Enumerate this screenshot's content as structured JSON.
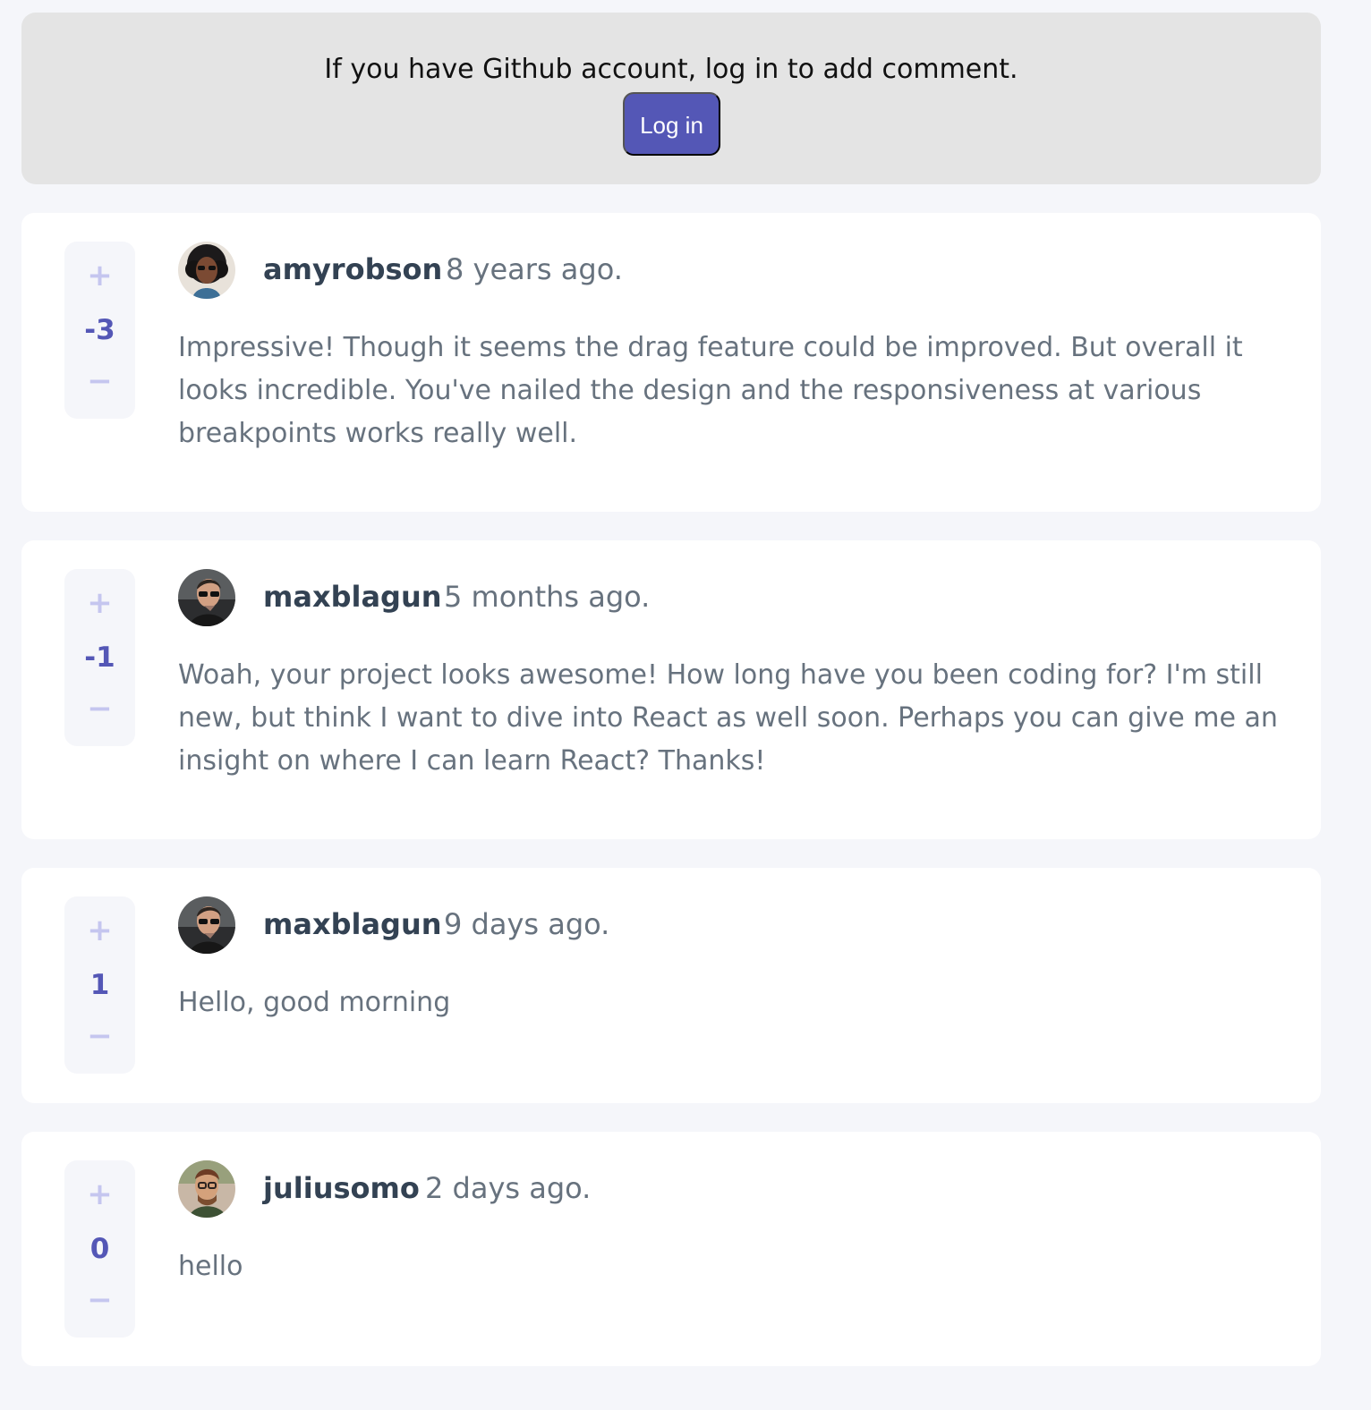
{
  "login_banner": {
    "text": "If you have Github account, log in to add comment.",
    "button_label": "Log in"
  },
  "comments": [
    {
      "score": "-3",
      "username": "amyrobson",
      "time": "8 years ago.",
      "text": "Impressive! Though it seems the drag feature could be improved. But overall it looks incredible. You've nailed the design and the responsiveness at various breakpoints works really well."
    },
    {
      "score": "-1",
      "username": "maxblagun",
      "time": "5 months ago.",
      "text": "Woah, your project looks awesome! How long have you been coding for? I'm still new, but think I want to dive into React as well soon. Perhaps you can give me an insight on where I can learn React? Thanks!"
    },
    {
      "score": "1",
      "username": "maxblagun",
      "time": "9 days ago.",
      "text": "Hello, good morning"
    },
    {
      "score": "0",
      "username": "juliusomo",
      "time": "2 days ago.",
      "text": "hello"
    }
  ],
  "vote_labels": {
    "plus": "+",
    "minus": "−"
  },
  "colors": {
    "page_background": "#f5f6fa",
    "banner_background": "#e4e4e4",
    "button_primary": "#5457b6",
    "vote_controls": "#c5c6ef",
    "username": "#334253",
    "body_text": "#67727e",
    "card_background": "#ffffff"
  },
  "icons": {
    "avatar_1": "avatar-amyrobson-icon",
    "avatar_2": "avatar-maxblagun-icon",
    "avatar_3": "avatar-maxblagun-icon",
    "avatar_4": "avatar-juliusomo-icon"
  }
}
